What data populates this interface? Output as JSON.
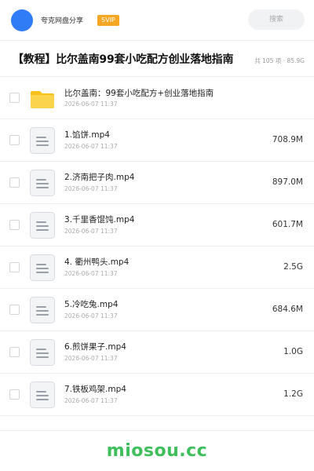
{
  "header": {
    "site_name": "夸克网盘分享",
    "badge": "SVIP",
    "search_placeholder": "搜索"
  },
  "share": {
    "title": "【教程】比尔盖南99套小吃配方创业落地指南",
    "meta": "共 105 项 · 85.9G"
  },
  "files": [
    {
      "type": "folder",
      "name": "比尔盖南：99套小吃配方+创业落地指南",
      "date": "2026-06-07 11:37",
      "size": ""
    },
    {
      "type": "file",
      "name": "1.馅饼.mp4",
      "date": "2026-06-07 11:37",
      "size": "708.9M"
    },
    {
      "type": "file",
      "name": "2.济南把子肉.mp4",
      "date": "2026-06-07 11:37",
      "size": "897.0M"
    },
    {
      "type": "file",
      "name": "3.千里香馄饨.mp4",
      "date": "2026-06-07 11:37",
      "size": "601.7M"
    },
    {
      "type": "file",
      "name": "4. 衢州鸭头.mp4",
      "date": "2026-06-07 11:37",
      "size": "2.5G"
    },
    {
      "type": "file",
      "name": "5.冷吃兔.mp4",
      "date": "2026-06-07 11:37",
      "size": "684.6M"
    },
    {
      "type": "file",
      "name": "6.煎饼果子.mp4",
      "date": "2026-06-07 11:37",
      "size": "1.0G"
    },
    {
      "type": "file",
      "name": "7.铁板鸡架.mp4",
      "date": "2026-06-07 11:37",
      "size": "1.2G"
    }
  ],
  "footer": {
    "brand": "miosou.cc"
  },
  "colors": {
    "avatar": "#2f7cf6",
    "svip_badge": "#f5a623",
    "folder": "#f9c21a",
    "brand": "#3fbf5b"
  },
  "icons": {
    "folder": "folder-icon",
    "file": "document-icon"
  }
}
